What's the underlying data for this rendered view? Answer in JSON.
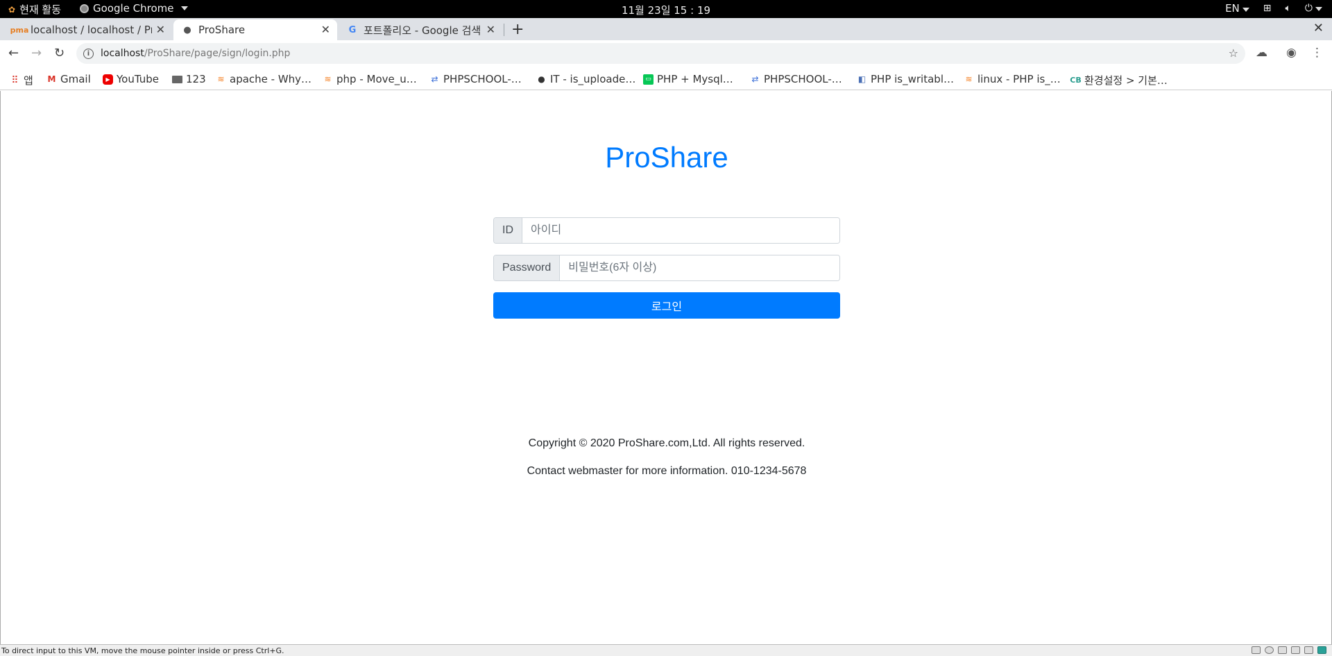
{
  "system_bar": {
    "activities": "현재 활동",
    "app_name": "Google Chrome",
    "clock": "11월 23일  15 : 19",
    "language": "EN"
  },
  "tabs": [
    {
      "title": "localhost / localhost / Pro",
      "icon": "phpmyadmin-icon"
    },
    {
      "title": "ProShare",
      "icon": "globe-icon"
    },
    {
      "title": "포트폴리오 - Google 검색",
      "icon": "google-icon"
    }
  ],
  "address_bar": {
    "host": "localhost",
    "path": "/ProShare/page/sign/login.php"
  },
  "bookmarks": [
    {
      "label": "앱",
      "icon": "apps-grid-icon"
    },
    {
      "label": "Gmail",
      "icon": "gmail-icon"
    },
    {
      "label": "YouTube",
      "icon": "youtube-icon"
    },
    {
      "label": "123",
      "icon": "folder-icon"
    },
    {
      "label": "apache - Why…",
      "icon": "stackoverflow-icon"
    },
    {
      "label": "php - Move_u…",
      "icon": "stackoverflow-icon"
    },
    {
      "label": "PHPSCHOOL-…",
      "icon": "phpschool-icon"
    },
    {
      "label": "IT - is_uploade…",
      "icon": "globe-icon"
    },
    {
      "label": "PHP + Mysql…",
      "icon": "line-icon"
    },
    {
      "label": "PHPSCHOOL-…",
      "icon": "phpschool-icon"
    },
    {
      "label": "PHP is_writabl…",
      "icon": "php-icon"
    },
    {
      "label": "linux - PHP is_…",
      "icon": "stackoverflow-icon"
    },
    {
      "label": "환경설정 > 기본…",
      "icon": "cb-icon"
    }
  ],
  "page": {
    "brand": "ProShare",
    "id_label": "ID",
    "id_placeholder": "아이디",
    "password_label": "Password",
    "password_placeholder": "비밀번호(6자 이상)",
    "login_button": "로그인",
    "copyright": "Copyright © 2020 ProShare.com,Ltd. All rights reserved.",
    "contact": "Contact webmaster for more information. 010-1234-5678"
  },
  "status_bar": {
    "message": "To direct input to this VM, move the mouse pointer inside or press Ctrl+G."
  },
  "colors": {
    "accent": "#007bff"
  }
}
